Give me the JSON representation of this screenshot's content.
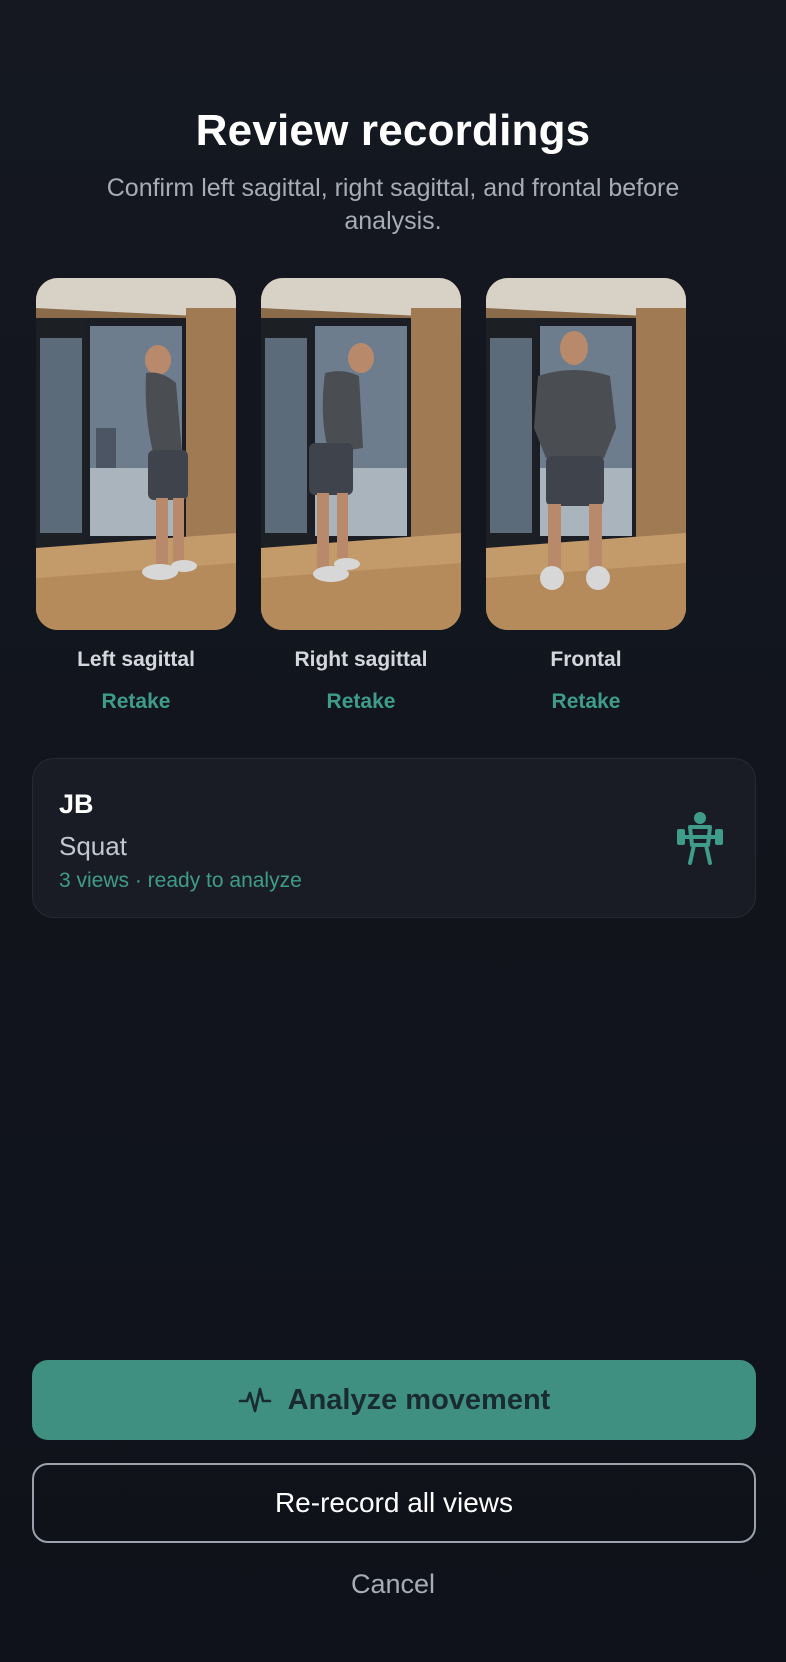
{
  "header": {
    "title": "Review recordings",
    "subtitle": "Confirm left sagittal, right sagittal, and frontal before analysis."
  },
  "recordings": [
    {
      "label": "Left sagittal",
      "action": "Retake"
    },
    {
      "label": "Right sagittal",
      "action": "Retake"
    },
    {
      "label": "Frontal",
      "action": "Retake"
    }
  ],
  "summary": {
    "initials": "JB",
    "exercise": "Squat",
    "status": "3 views · ready to analyze",
    "icon": "weightlifter-icon"
  },
  "actions": {
    "analyze_label": "Analyze movement",
    "analyze_icon": "pulse-icon",
    "rerecord_label": "Re-record all views",
    "cancel_label": "Cancel"
  },
  "colors": {
    "accent": "#3f9c8a",
    "primary_button": "#3f9080",
    "background": "#12151d",
    "card": "#1a1c25"
  }
}
